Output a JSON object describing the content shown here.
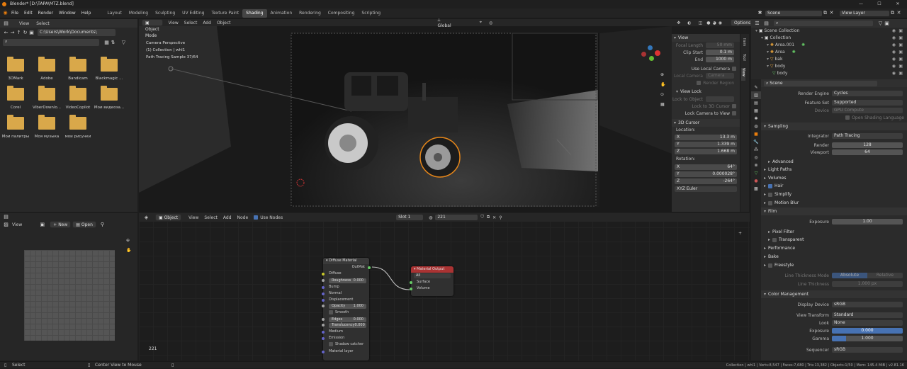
{
  "title": "Blender* [D:\\TAPA\\MTZ.blend]",
  "menu": [
    "File",
    "Edit",
    "Render",
    "Window",
    "Help"
  ],
  "workspaces": [
    "Layout",
    "Modeling",
    "Sculpting",
    "UV Editing",
    "Texture Paint",
    "Shading",
    "Animation",
    "Rendering",
    "Compositing",
    "Scripting"
  ],
  "active_workspace": "Shading",
  "scene": {
    "name": "Scene",
    "view_layer": "View Layer"
  },
  "file_browser": {
    "menus": [
      "View",
      "Select"
    ],
    "path": "C:\\Users\\Work\\Documents\\",
    "folders": [
      "3DMark",
      "Adobe",
      "Bandicam",
      "Blackmagic ...",
      "Corel",
      "ViberDownlo...",
      "VideoCopilot",
      "Мои видеоза...",
      "Мои палитры",
      "Моя музыка",
      "мои рисунки"
    ]
  },
  "viewport": {
    "mode": "Object Mode",
    "menus": [
      "View",
      "Select",
      "Add",
      "Object"
    ],
    "orientation": "Global",
    "options": "Options",
    "overlay": [
      "Camera Perspective",
      "(1) Collection | whl1",
      "Path Tracing Sample 37/64"
    ],
    "view_panel": {
      "section_view": "View",
      "focal_length_label": "Focal Length",
      "focal_length": "50 mm",
      "clip_start_label": "Clip Start",
      "clip_start": "0.1 m",
      "end_label": "End",
      "end": "1000 m",
      "use_local_camera": "Use Local Camera",
      "local_camera_label": "Local Camera",
      "local_camera": "Camera",
      "render_region": "Render Region",
      "section_view_lock": "View Lock",
      "lock_to_object": "Lock to Object",
      "lock_to_3d_cursor": "Lock to 3D Cursor",
      "lock_camera_to_view": "Lock Camera to View",
      "section_cursor": "3D Cursor",
      "location_label": "Location:",
      "loc": [
        [
          "X",
          "13.3 m"
        ],
        [
          "Y",
          "1.339 m"
        ],
        [
          "Z",
          "1.668 m"
        ]
      ],
      "rotation_label": "Rotation:",
      "rot": [
        [
          "X",
          "64°"
        ],
        [
          "Y",
          "0.000028°"
        ],
        [
          "Z",
          "-264°"
        ]
      ],
      "rotation_mode": "XYZ Euler"
    },
    "side_tabs": [
      "Item",
      "Tool",
      "View"
    ]
  },
  "image_editor": {
    "menu": "View",
    "new": "New",
    "open": "Open"
  },
  "node_editor": {
    "type": "Object",
    "menus": [
      "View",
      "Select",
      "Add",
      "Node"
    ],
    "use_nodes": "Use Nodes",
    "slot": "Slot 1",
    "material": "221",
    "frame_label": "221",
    "diffuse_node": {
      "title": "Diffuse Material",
      "output": "OutMat",
      "rows": [
        {
          "label": "Diffuse",
          "value": ""
        },
        {
          "label": "Roughness",
          "value": "0.000",
          "field": true
        },
        {
          "label": "Bump",
          "value": ""
        },
        {
          "label": "Normal",
          "value": ""
        },
        {
          "label": "Displacement",
          "value": ""
        },
        {
          "label": "Opacity",
          "value": "1.000",
          "field": true
        },
        {
          "label": "Smooth",
          "value": "",
          "check": true
        },
        {
          "label": "Edges round",
          "value": "0.000",
          "field": true
        },
        {
          "label": "Translucency",
          "value": "0.000",
          "field": true
        },
        {
          "label": "Medium",
          "value": ""
        },
        {
          "label": "Emission",
          "value": ""
        },
        {
          "label": "Shadow catcher",
          "value": "",
          "check": true
        },
        {
          "label": "Material layer",
          "value": ""
        }
      ]
    },
    "output_node": {
      "title": "Material Output",
      "target": "All",
      "inputs": [
        "Surface",
        "Volume"
      ]
    }
  },
  "outliner": {
    "items": [
      {
        "label": "Scene Collection",
        "indent": 0,
        "icon": "collection"
      },
      {
        "label": "Collection",
        "indent": 1,
        "icon": "collection"
      },
      {
        "label": "Area.001",
        "indent": 2,
        "icon": "light"
      },
      {
        "label": "Area",
        "indent": 2,
        "icon": "light"
      },
      {
        "label": "bak",
        "indent": 2,
        "icon": "mesh"
      },
      {
        "label": "body",
        "indent": 2,
        "icon": "mesh"
      },
      {
        "label": "body",
        "indent": 3,
        "icon": "mesh-data"
      }
    ]
  },
  "properties": {
    "scene_label": "Scene",
    "render_engine_label": "Render Engine",
    "render_engine": "Cycles",
    "feature_set_label": "Feature Set",
    "feature_set": "Supported",
    "device_label": "Device",
    "device": "GPU Compute",
    "osl": "Open Shading Language",
    "sampling": "Sampling",
    "integrator_label": "Integrator",
    "integrator": "Path Tracing",
    "render_label": "Render",
    "render": "128",
    "viewport_label": "Viewport",
    "viewport": "64",
    "advanced": "Advanced",
    "light_paths": "Light Paths",
    "volumes": "Volumes",
    "hair": "Hair",
    "simplify": "Simplify",
    "motion_blur": "Motion Blur",
    "film": "Film",
    "exposure_label": "Exposure",
    "exposure": "1.00",
    "pixel_filter": "Pixel Filter",
    "transparent": "Transparent",
    "performance": "Performance",
    "bake": "Bake",
    "freestyle": "Freestyle",
    "line_mode_label": "Line Thickness Mode",
    "line_mode_a": "Absolute",
    "line_mode_b": "Relative",
    "line_thickness_label": "Line Thickness",
    "line_thickness": "1.000 px",
    "color_management": "Color Management",
    "display_device_label": "Display Device",
    "display_device": "sRGB",
    "view_transform_label": "View Transform",
    "view_transform": "Standard",
    "look_label": "Look",
    "look": "None",
    "cm_exposure_label": "Exposure",
    "cm_exposure": "0.000",
    "gamma_label": "Gamma",
    "gamma": "1.000",
    "sequencer_label": "Sequencer",
    "sequencer": "sRGB"
  },
  "statusbar": {
    "select": "Select",
    "center": "Center View to Mouse",
    "stats": "Collection | whl1 | Verts:8,547 | Faces:7,680 | Tris:13,382 | Objects:1/50 | Mem: 145.4 MiB | v2.81.16"
  }
}
